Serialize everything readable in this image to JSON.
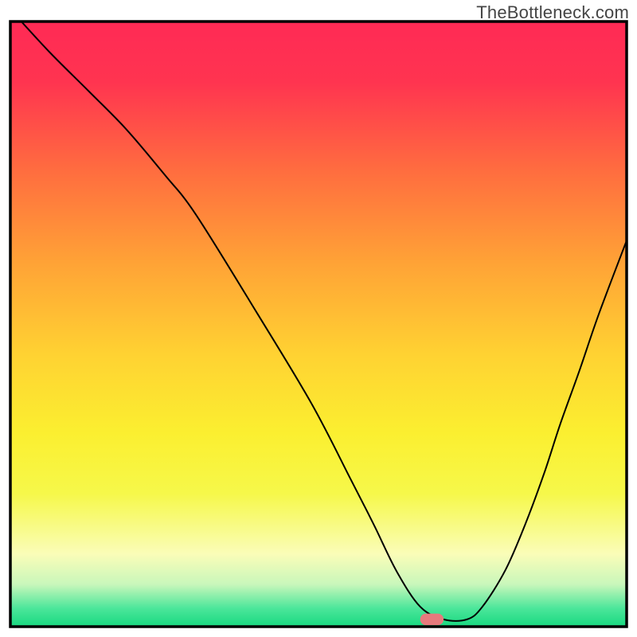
{
  "watermark": "TheBottleneck.com",
  "chart_data": {
    "type": "line",
    "title": "",
    "xlabel": "",
    "ylabel": "",
    "xlim": [
      0,
      100
    ],
    "ylim": [
      0,
      100
    ],
    "axes_visible": false,
    "grid": false,
    "background": {
      "type": "vertical_gradient",
      "stops": [
        {
          "offset": 0.0,
          "color": "#ff2a55"
        },
        {
          "offset": 0.1,
          "color": "#ff3450"
        },
        {
          "offset": 0.25,
          "color": "#ff6e3f"
        },
        {
          "offset": 0.4,
          "color": "#ffa336"
        },
        {
          "offset": 0.55,
          "color": "#ffd232"
        },
        {
          "offset": 0.68,
          "color": "#fbef30"
        },
        {
          "offset": 0.78,
          "color": "#f6f84a"
        },
        {
          "offset": 0.88,
          "color": "#fafdb8"
        },
        {
          "offset": 0.93,
          "color": "#c9f7bb"
        },
        {
          "offset": 0.97,
          "color": "#4be69a"
        },
        {
          "offset": 1.0,
          "color": "#18d880"
        }
      ]
    },
    "series": [
      {
        "name": "bottleneck_curve",
        "stroke": "#000000",
        "stroke_width": 2,
        "x": [
          0.0,
          6.3,
          12.6,
          18.8,
          25.1,
          30.1,
          40.1,
          48.9,
          55.2,
          59.0,
          62.7,
          66.5,
          70.3,
          74.1,
          76.6,
          80.3,
          83.5,
          86.6,
          89.2,
          92.3,
          95.5,
          100.0
        ],
        "y": [
          102.0,
          95.0,
          88.6,
          82.2,
          74.6,
          68.1,
          51.7,
          36.8,
          24.4,
          16.8,
          9.1,
          3.3,
          1.2,
          1.2,
          3.3,
          9.3,
          16.8,
          25.3,
          33.4,
          42.2,
          51.7,
          63.8
        ]
      }
    ],
    "marker": {
      "name": "optimal_zone_marker",
      "shape": "rounded_rect",
      "x": 68.4,
      "y": 1.2,
      "width": 3.8,
      "height": 1.9,
      "fill": "#e77a7d"
    },
    "frame": {
      "stroke": "#000000",
      "stroke_width": 3.5
    }
  }
}
